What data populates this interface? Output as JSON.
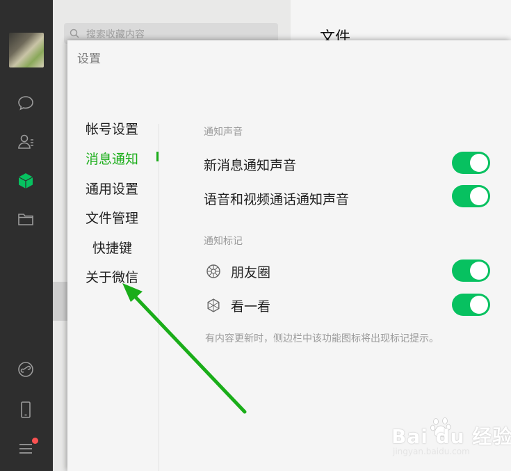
{
  "search": {
    "placeholder": "搜索收藏内容"
  },
  "main": {
    "title": "文件"
  },
  "dialog": {
    "title": "设置",
    "nav": [
      {
        "label": "帐号设置",
        "active": false
      },
      {
        "label": "消息通知",
        "active": true
      },
      {
        "label": "通用设置",
        "active": false
      },
      {
        "label": "文件管理",
        "active": false
      },
      {
        "label": "快捷键",
        "active": false
      },
      {
        "label": "关于微信",
        "active": false
      }
    ],
    "sections": {
      "sound": {
        "label": "通知声音",
        "rows": [
          {
            "label": "新消息通知声音",
            "on": true
          },
          {
            "label": "语音和视频通话通知声音",
            "on": true
          }
        ]
      },
      "badge": {
        "label": "通知标记",
        "rows": [
          {
            "label": "朋友圈",
            "icon": "moments-icon",
            "on": true
          },
          {
            "label": "看一看",
            "icon": "top-stories-icon",
            "on": true
          }
        ],
        "hint": "有内容更新时，侧边栏中该功能图标将出现标记提示。"
      }
    }
  },
  "watermark": {
    "brand": "Bai du 经验",
    "url": "jingyan.baidu.com"
  },
  "colors": {
    "accent": "#1aad19",
    "toggle_on": "#07c160",
    "rail": "#2e2e2e",
    "badge": "#fa5151"
  }
}
